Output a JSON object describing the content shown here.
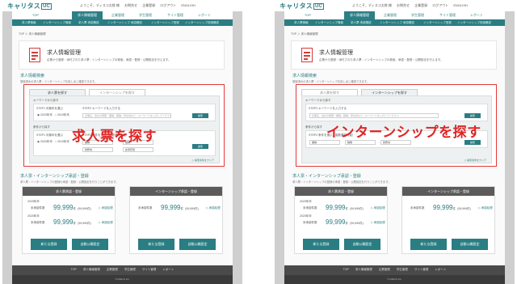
{
  "site": {
    "logo": "キャリタス",
    "logo_mark": "UC",
    "user_items": [
      "ようこそ、ディスコ太郎 様",
      "お問合せ",
      "企業登録",
      "ログアウト",
      "ENGLISH"
    ]
  },
  "nav": [
    "TOP",
    "求人情報管理",
    "企業管理",
    "学生管理",
    "サイト管理",
    "レポート"
  ],
  "subnav": [
    "求人票情報",
    "インターンシップ情報",
    "求人票 承認確認",
    "インターンシップ 承認確認",
    "インターンシップ登録",
    "インターンシップ詳細確認"
  ],
  "breadcrumb": "TOP ＞ 求人情報管理",
  "page": {
    "title": "求人情報管理",
    "desc": "企業から登録・添付された求人票・インターンシップの検索、承認・登録・公開設定を行えます。"
  },
  "search_section": {
    "title": "求人情報検索",
    "desc": "登録済みの求人票・インターンシップを探し出し確認できます。"
  },
  "tabs": [
    "求人票を探す",
    "インターンシップを探す"
  ],
  "search": {
    "keyword_label": "キーワードから探す",
    "keyword_step": "STEP2 キーワードを入力する",
    "keyword_placeholder": "企業名、会社の概要・業種、職種、所在地など、キーワードを入力してください",
    "search_button": "検索",
    "year_step": "STEP1 対象年を選ぶ",
    "years": [
      "2020年卒",
      "2019年卒"
    ],
    "condition_label": "条件から探す",
    "condition_step": "STEP2 条件を選ぶ（複数選択可能）",
    "selects": [
      "業種",
      "職種",
      "勤務地",
      "雇用形態"
    ],
    "clear_link": "▷ 検索条件をクリア"
  },
  "overlays": {
    "left": "求人票を探す",
    "right": "インターンシップを探す"
  },
  "register_section": {
    "title": "求人票・インターンシップ承認・登録",
    "desc": "求人票・インターンシップの登録の承認・登録・公開設定を行うことができます。"
  },
  "cards": [
    {
      "title": "求人票承認・登録",
      "year": "2020年卒",
      "row_label": "未承認件数",
      "price": "99,999",
      "unit": "件",
      "sub": "(99,999件)",
      "link": "▷ 承認処理",
      "button_1": "新たな登録",
      "button_2": "自動公開設定"
    },
    {
      "title": "インターンシップ承認・登録",
      "year": "",
      "row_label": "未承認件数",
      "price": "99,999",
      "unit": "件",
      "sub": "(99,999件)",
      "link": "▷ 承認処理",
      "button_1": "新たな登録",
      "button_2": "自動公開設定"
    }
  ],
  "footer": {
    "links": [
      "TOP",
      "求人情報管理",
      "企業管理",
      "学生管理",
      "サイト管理",
      "レポート"
    ],
    "copyright": "© DISCO Inc."
  },
  "colors": {
    "brand": "#2a7d82",
    "highlight": "#e02424"
  }
}
